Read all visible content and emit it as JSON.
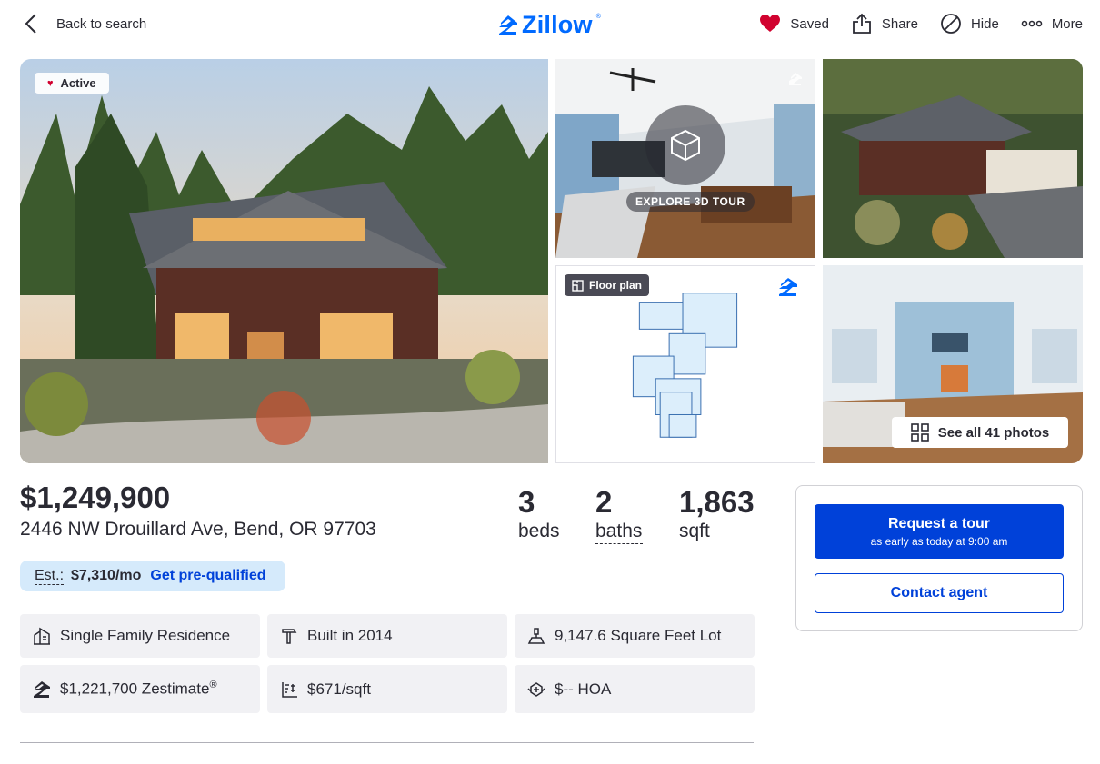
{
  "header": {
    "back_label": "Back to search",
    "logo_text": "Zillow",
    "logo_reg": "®",
    "actions": {
      "saved": "Saved",
      "share": "Share",
      "hide": "Hide",
      "more": "More"
    }
  },
  "gallery": {
    "status_badge": "Active",
    "tour_label": "EXPLORE 3D TOUR",
    "floorplan_label": "Floor plan",
    "see_all_label": "See all 41 photos"
  },
  "listing": {
    "price": "$1,249,900",
    "address": "2446 NW Drouillard Ave, Bend, OR 97703",
    "beds_value": "3",
    "beds_label": "beds",
    "baths_value": "2",
    "baths_label": "baths",
    "sqft_value": "1,863",
    "sqft_label": "sqft"
  },
  "estimate": {
    "label": "Est.:",
    "amount": "$7,310/mo",
    "cta": "Get pre-qualified"
  },
  "facts": [
    {
      "icon": "home-type-icon",
      "text": "Single Family Residence"
    },
    {
      "icon": "hammer-icon",
      "text": "Built in 2014"
    },
    {
      "icon": "lot-size-icon",
      "text": "9,147.6 Square Feet Lot"
    },
    {
      "icon": "zestimate-icon",
      "text": "$1,221,700 Zestimate",
      "sup": "®"
    },
    {
      "icon": "price-per-sqft-icon",
      "text": "$671/sqft"
    },
    {
      "icon": "hoa-icon",
      "text": "$-- HOA"
    }
  ],
  "contact": {
    "tour_title": "Request a tour",
    "tour_subtitle": "as early as today at 9:00 am",
    "contact_label": "Contact agent"
  },
  "colors": {
    "brand": "#006aff",
    "primary_button": "#0041d9",
    "saved_heart": "#d1022f",
    "estimate_bg": "#d5eafb",
    "fact_bg": "#f1f1f4"
  }
}
